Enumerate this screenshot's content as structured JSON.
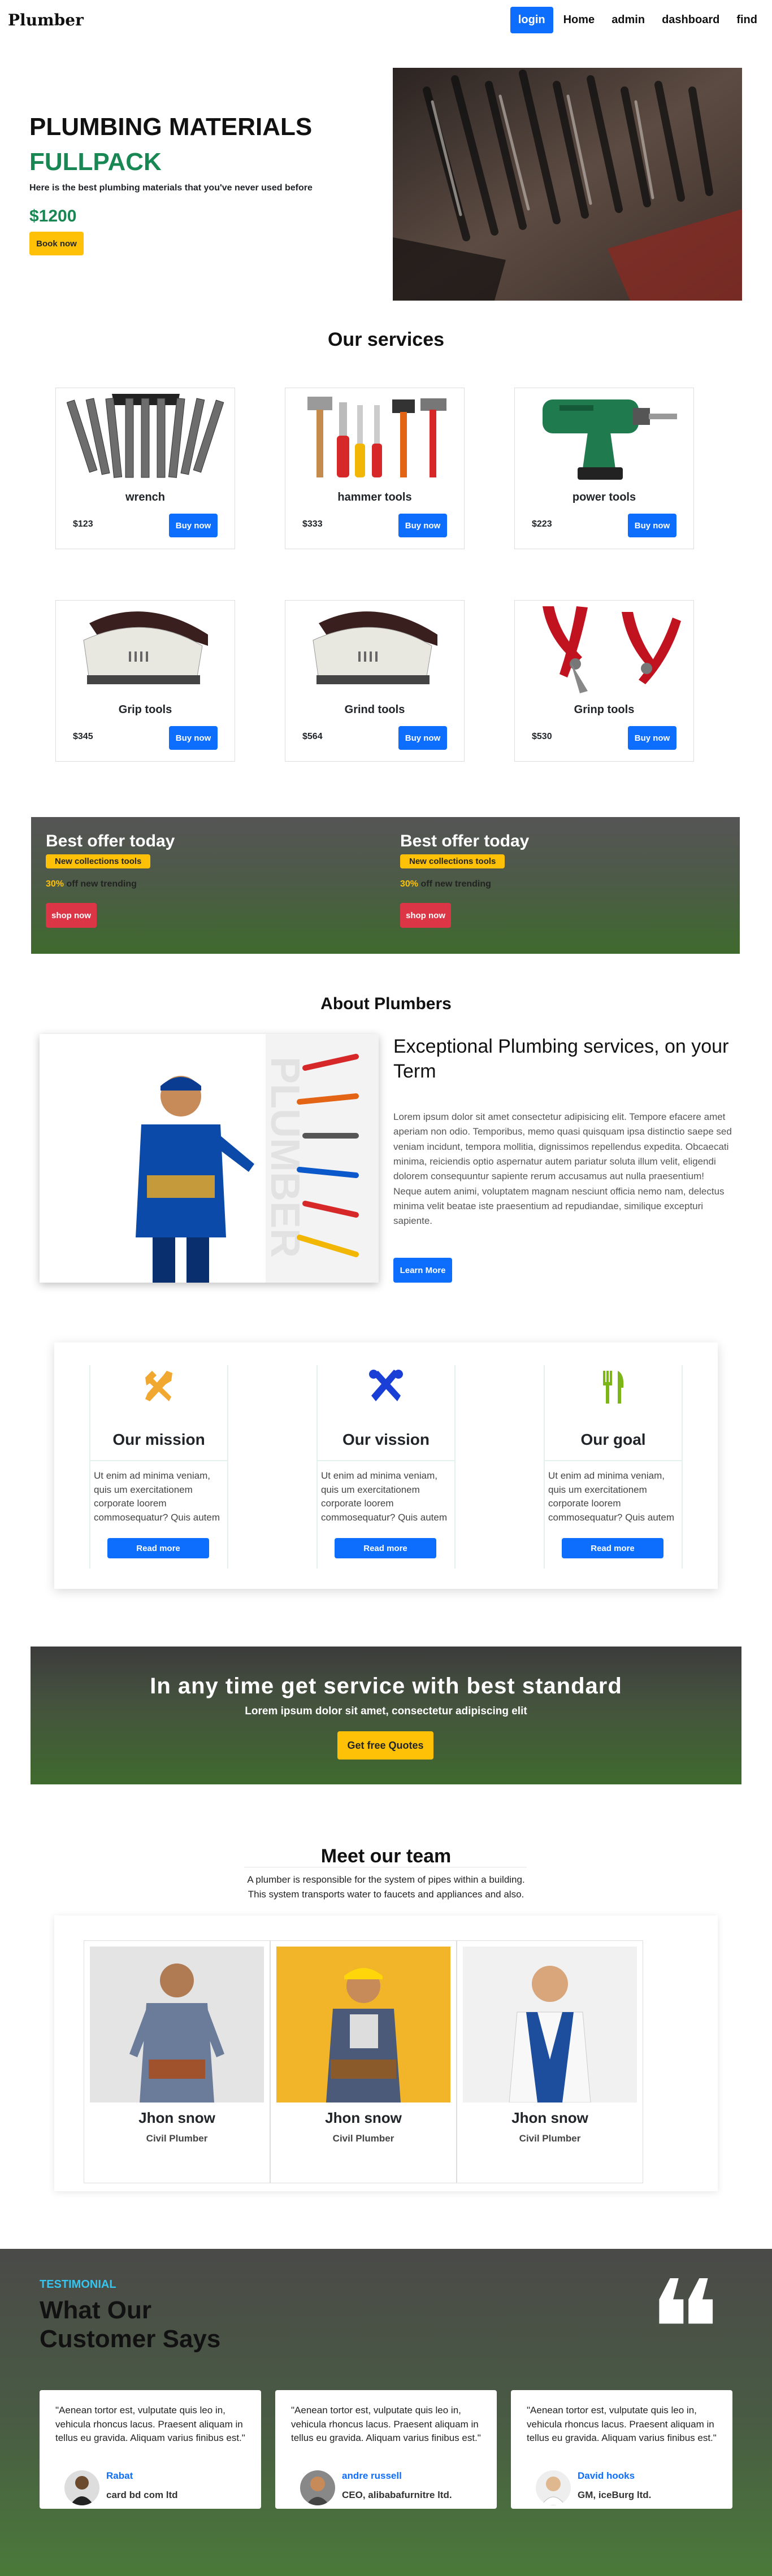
{
  "nav": {
    "brand": "Plumber",
    "links": [
      "login",
      "Home",
      "admin",
      "dashboard",
      "find"
    ]
  },
  "hero": {
    "title": "PLUMBING MATERIALS",
    "subtitle": "FULLPACK",
    "description": "Here is the best plumbing materials that you've never used before",
    "price": "$1200",
    "button": "Book now"
  },
  "services": {
    "title": "Our services",
    "items": [
      {
        "name": "wrench",
        "price": "$123",
        "button": "Buy now",
        "icon": "wrench-set-icon"
      },
      {
        "name": "hammer tools",
        "price": "$333",
        "button": "Buy now",
        "icon": "hammer-tools-icon"
      },
      {
        "name": "power tools",
        "price": "$223",
        "button": "Buy now",
        "icon": "power-drill-icon"
      },
      {
        "name": "Grip tools",
        "price": "$345",
        "button": "Buy now",
        "icon": "sander-icon"
      },
      {
        "name": "Grind tools",
        "price": "$564",
        "button": "Buy now",
        "icon": "sander-icon"
      },
      {
        "name": "Grinp tools",
        "price": "$530",
        "button": "Buy now",
        "icon": "pliers-icon"
      }
    ]
  },
  "offers": [
    {
      "title": "Best offer today",
      "badge": "New collections tools",
      "percent": "30%",
      "percent_text": "off new trending",
      "button": "shop now"
    },
    {
      "title": "Best offer today",
      "badge": "New collections tools",
      "percent": "30%",
      "percent_text": "off new trending",
      "button": "shop now"
    }
  ],
  "about": {
    "title": "About Plumbers",
    "heading": "Exceptional Plumbing services, on your Term",
    "image_word": "PLUMBER",
    "paragraph": "Lorem ipsum dolor sit amet consectetur adipisicing elit. Tempore efacere amet aperiam non odio. Temporibus, memo quasi quisquam ipsa distinctio saepe sed veniam incidunt, tempora mollitia, dignissimos repellendus expedita. Obcaecati minima, reiciendis optio aspernatur autem pariatur soluta illum velit, eligendi dolorem consequuntur sapiente rerum accusamus aut nulla praesentium! Neque autem animi, voluptatem magnam nesciunt officia nemo nam, delectus minima velit beatae iste praesentium ad repudiandae, similique excepturi sapiente.",
    "button": "Learn More"
  },
  "missions": [
    {
      "title": "Our mission",
      "text": "Ut enim ad minima veniam, quis um exercitationem corporate loorem commosequatur? Quis autem",
      "button": "Read more",
      "icon": "tools-icon",
      "color": "#f0a830"
    },
    {
      "title": "Our vission",
      "text": "Ut enim ad minima veniam, quis um exercitationem corporate loorem commosequatur? Quis autem",
      "button": "Read more",
      "icon": "crossed-tools-icon",
      "color": "#1a3fd6"
    },
    {
      "title": "Our goal",
      "text": "Ut enim ad minima veniam, quis um exercitationem corporate loorem commosequatur? Quis autem",
      "button": "Read more",
      "icon": "fork-knife-icon",
      "color": "#7cb518"
    }
  ],
  "banner": {
    "heading": "In any time get service with best standard",
    "sub": "Lorem ipsum dolor sit amet, consectetur adipiscing elit",
    "button": "Get free Quotes"
  },
  "team": {
    "title": "Meet our team",
    "desc1": "A plumber is responsible for the system of pipes within a building.",
    "desc2": "This system transports water to faucets and appliances and also.",
    "members": [
      {
        "name": "Jhon snow",
        "role": "Civil Plumber"
      },
      {
        "name": "Jhon snow",
        "role": "Civil Plumber"
      },
      {
        "name": "Jhon snow",
        "role": "Civil Plumber"
      }
    ]
  },
  "testimonial": {
    "label": "TESTIMONIAL",
    "heading": "What Our Customer Says",
    "quote_mark": "❝",
    "cards": [
      {
        "quote": "\"Aenean tortor est, vulputate quis leo in, vehicula rhoncus lacus. Praesent aliquam in tellus eu gravida. Aliquam varius finibus est.\"",
        "name": "Rabat",
        "company": "card bd com ltd"
      },
      {
        "quote": "\"Aenean tortor est, vulputate quis leo in, vehicula rhoncus lacus. Praesent aliquam in tellus eu gravida. Aliquam varius finibus est.\"",
        "name": "andre russell",
        "company": "CEO, alibabafurnitre ltd."
      },
      {
        "quote": "\"Aenean tortor est, vulputate quis leo in, vehicula rhoncus lacus. Praesent aliquam in tellus eu gravida. Aliquam varius finibus est.\"",
        "name": "David hooks",
        "company": "GM, iceBurg ltd."
      }
    ]
  }
}
